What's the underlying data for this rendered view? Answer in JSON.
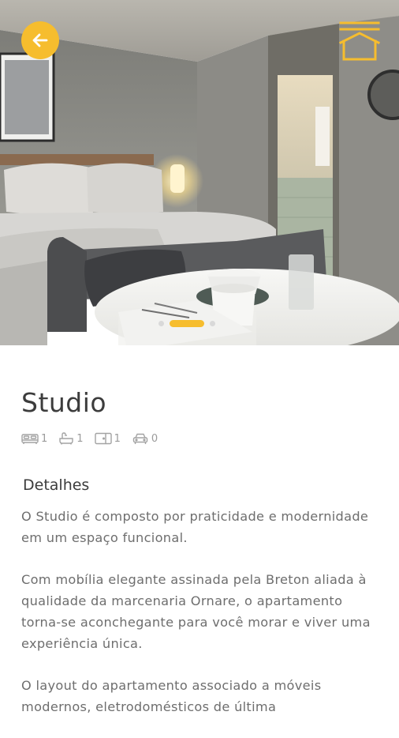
{
  "header": {
    "back_icon": "arrow-left-icon",
    "home_icon": "home-icon",
    "accent_color": "#f6bd2e"
  },
  "gallery": {
    "image_subject": "studio apartment bedroom with round table",
    "page_count": 3,
    "active_page": 1
  },
  "listing": {
    "title": "Studio",
    "features": [
      {
        "icon": "bed-icon",
        "count": "1"
      },
      {
        "icon": "bathtub-icon",
        "count": "1"
      },
      {
        "icon": "suite-icon",
        "count": "1"
      },
      {
        "icon": "car-icon",
        "count": "0"
      }
    ]
  },
  "details": {
    "heading": "Detalhes",
    "paragraphs": [
      "O Studio é composto por praticidade e modernidade em um espaço funcional.",
      "Com mobília elegante assinada pela Breton aliada à qualidade da marcenaria Ornare, o apartamento torna-se aconchegante para você morar e viver uma experiência única.",
      "O layout do apartamento associado a móveis modernos, eletrodomésticos de última"
    ]
  }
}
